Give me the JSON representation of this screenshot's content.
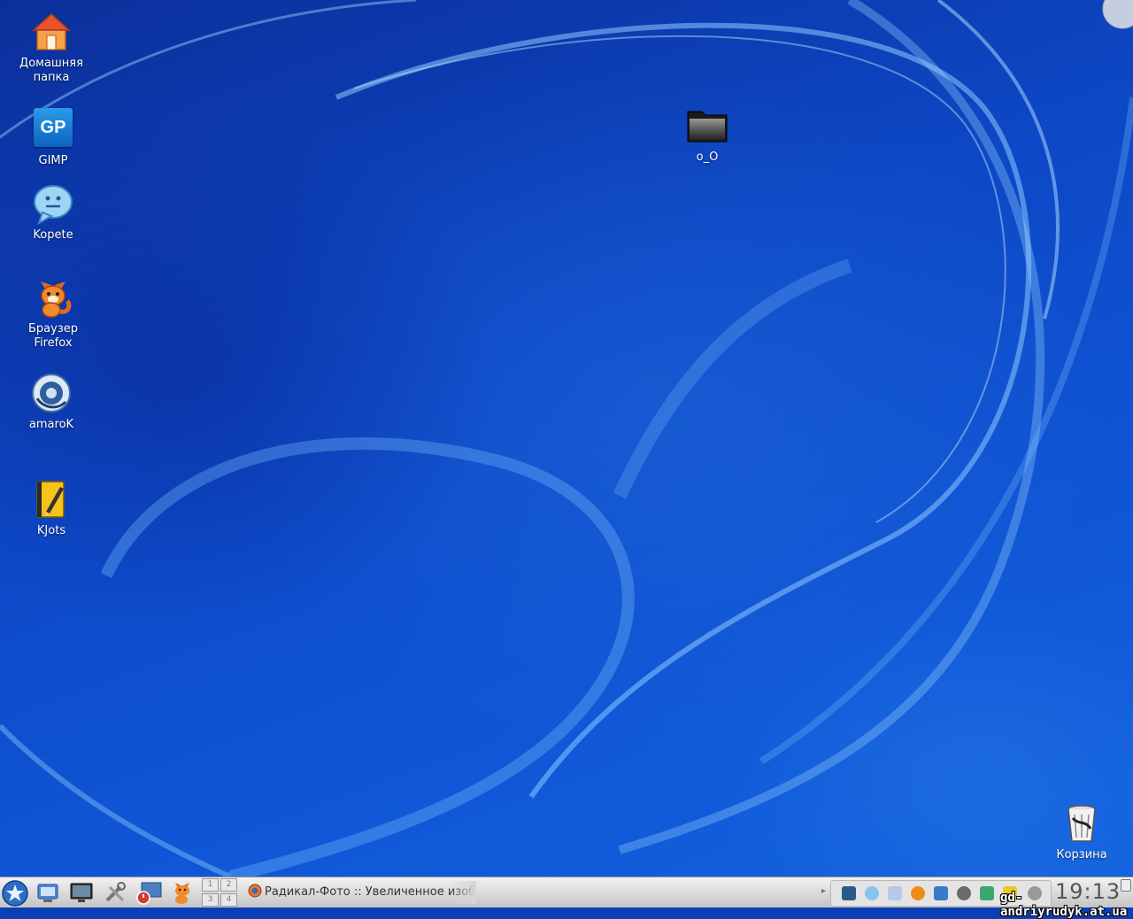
{
  "desktop": {
    "icons": [
      {
        "label": "Домашняя\nпапка",
        "icon": "home-folder-icon"
      },
      {
        "label": "GIMP",
        "icon": "gimp-icon",
        "badge": "GP"
      },
      {
        "label": "Kopete",
        "icon": "kopete-icon"
      },
      {
        "label": "Браузер\nFirefox",
        "icon": "firefox-icon"
      },
      {
        "label": "amaroK",
        "icon": "amarok-icon"
      },
      {
        "label": "KJots",
        "icon": "kjots-icon"
      },
      {
        "label": "o_O",
        "icon": "folder-icon"
      },
      {
        "label": "Корзина",
        "icon": "trash-icon"
      }
    ]
  },
  "taskbar": {
    "pager": [
      "1",
      "2",
      "3",
      "4"
    ],
    "task_title": "Радикал-Фото :: Увеличенное изоб",
    "clock": "19:13",
    "watermark": "gd-andriyrudyk.at.ua"
  },
  "colors": {
    "desktop_bg": "#0d48c6",
    "taskbar_bg": "#d9d9d9",
    "label_text": "#ffffff"
  }
}
